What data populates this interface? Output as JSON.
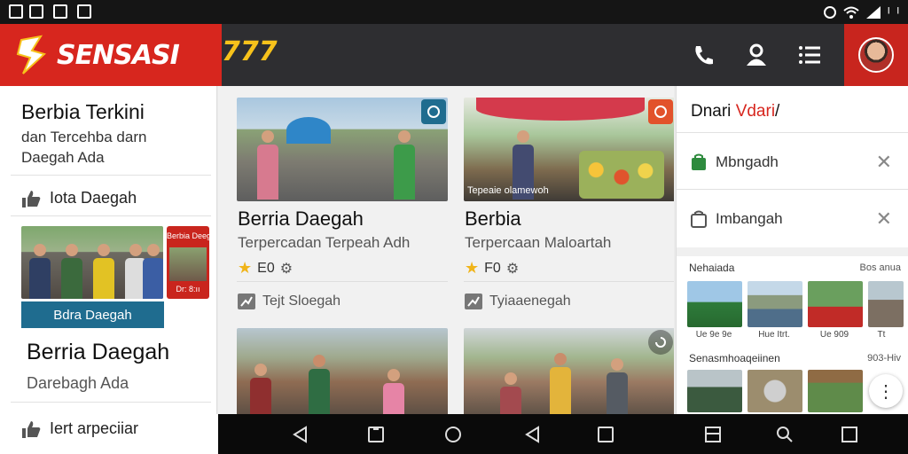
{
  "status_bar": {
    "left_icons": [
      "image-icon",
      "square-icon",
      "photo-icon",
      "chart-icon"
    ],
    "right_text": "ᴵ"
  },
  "status": {
    "battery_text": "ᴵ",
    "battery": "ᴵ"
  },
  "app": {
    "brand_name": "SENSASI",
    "brand_number": "777"
  },
  "left_panel": {
    "title": "Berbia Terkini",
    "subtitle_line1": "dan Tercehba darn",
    "subtitle_line2": "Daegah Ada",
    "section1": "Iota Daegah",
    "promo_badge": "Berbia Deeger",
    "promo_badge_bottom": "Dr: 8:ıı",
    "promo_button": "Bdra Daegah",
    "headline": "Berria Daegah",
    "headline_sub": "Darebagh Ada",
    "section2": "Iert arpeciiar"
  },
  "cards": [
    {
      "title": "Berria Daegah",
      "subtitle": "Terpercadan Terpeah Adh",
      "rating": "E0",
      "footer": "Tejt Sloegah",
      "image_caption": ""
    },
    {
      "title": "Berbia",
      "subtitle": "Terpercaan Maloartah",
      "rating": "F0",
      "footer": "Tyiaaenegah",
      "image_caption": "Tepeaie olamewoh"
    }
  ],
  "right_panel": {
    "title_part1": "Dnari ",
    "title_part2": "Vdari",
    "title_part3": "/",
    "items": [
      {
        "label": "Mbngadh"
      },
      {
        "label": "Imbangah"
      }
    ],
    "gallery1_label": "Nehaiada",
    "gallery1_count": "Bos anua",
    "gallery1_captions": [
      "Ue 9e 9e",
      "Hue Itrt.",
      "Ue 909",
      "Tt"
    ],
    "gallery2_label": "Senasmhoaqeiinen",
    "gallery2_count": "903-Hiv"
  },
  "colors": {
    "brand_red": "#d7261e",
    "appbar_dark": "#2e2e31",
    "accent_yellow": "#f7c21b",
    "button_teal": "#1f6c8f",
    "status_green": "#2e8b3e"
  }
}
